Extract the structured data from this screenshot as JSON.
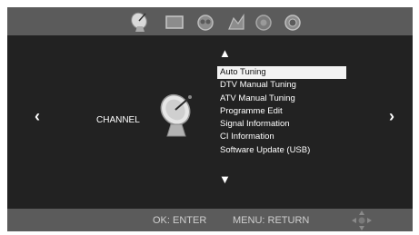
{
  "top_icons": [
    {
      "name": "satellite-dish-icon",
      "selected": true
    },
    {
      "name": "picture-icon",
      "selected": false
    },
    {
      "name": "sound-icon",
      "selected": false
    },
    {
      "name": "time-icon",
      "selected": false
    },
    {
      "name": "lock-icon",
      "selected": false
    },
    {
      "name": "setup-icon",
      "selected": false
    }
  ],
  "page": {
    "title": "CHANNEL",
    "left_arrow": "‹",
    "right_arrow": "›"
  },
  "menu": {
    "scroll_up": "▲",
    "scroll_down": "▼",
    "items": [
      {
        "label": "Auto Tuning",
        "selected": true
      },
      {
        "label": "DTV Manual Tuning",
        "selected": false
      },
      {
        "label": "ATV Manual Tuning",
        "selected": false
      },
      {
        "label": "Programme Edit",
        "selected": false
      },
      {
        "label": "Signal Information",
        "selected": false
      },
      {
        "label": "CI Information",
        "selected": false
      },
      {
        "label": "Software Update (USB)",
        "selected": false
      }
    ]
  },
  "footer": {
    "ok_hint": "OK: ENTER",
    "menu_hint": "MENU: RETURN"
  },
  "colors": {
    "background": "#222222",
    "bars": "#5b5b5b",
    "highlight": "#f3f3f3"
  }
}
